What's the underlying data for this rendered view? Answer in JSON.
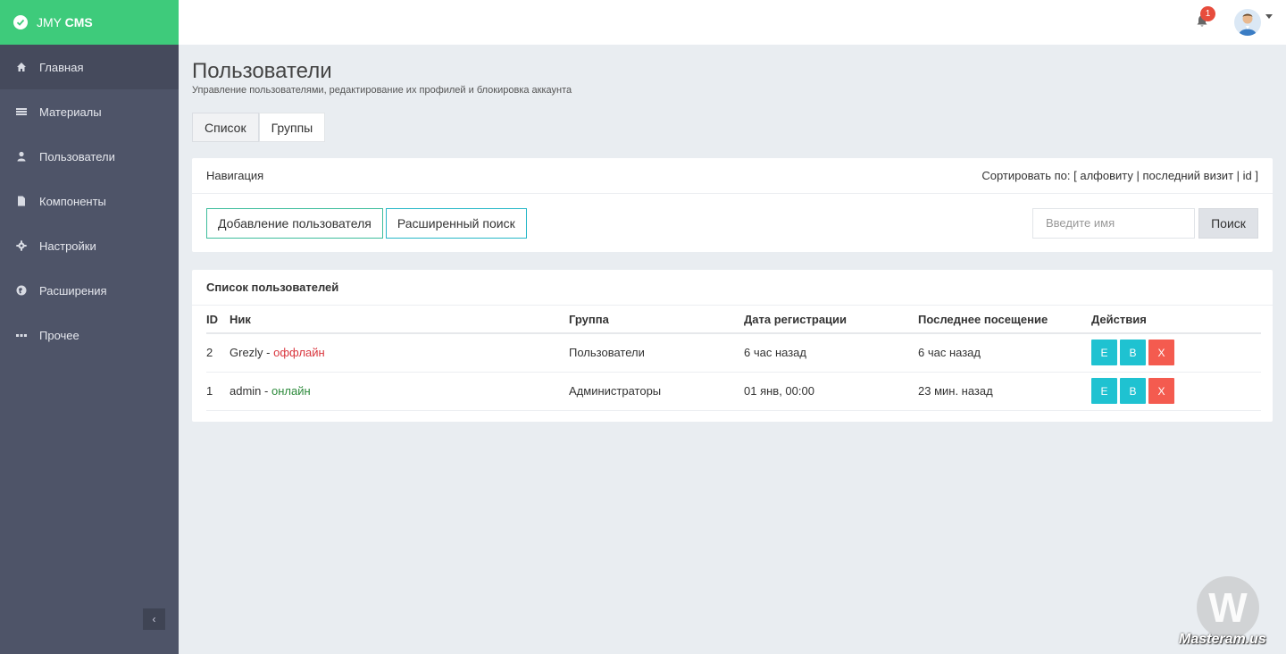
{
  "brand": {
    "prefix": "JMY ",
    "strong": "CMS"
  },
  "sidebar": {
    "items": [
      {
        "label": "Главная",
        "icon": "home-icon"
      },
      {
        "label": "Материалы",
        "icon": "list-icon"
      },
      {
        "label": "Пользователи",
        "icon": "user-icon"
      },
      {
        "label": "Компоненты",
        "icon": "file-icon"
      },
      {
        "label": "Настройки",
        "icon": "gear-icon"
      },
      {
        "label": "Расширения",
        "icon": "globe-icon"
      },
      {
        "label": "Прочее",
        "icon": "ellipsis-icon"
      }
    ],
    "collapse_symbol": "‹"
  },
  "topbar": {
    "notification_count": "1"
  },
  "page": {
    "title": "Пользователи",
    "subtitle": "Управление пользователями, редактирование их профилей и блокировка аккаунта"
  },
  "tabs": [
    {
      "label": "Список"
    },
    {
      "label": "Группы"
    }
  ],
  "nav_panel": {
    "title": "Навигация",
    "sort_prefix": "Сортировать по: [ ",
    "sort_alpha": "алфовиту",
    "sort_sep1": " | ",
    "sort_visit": "последний визит",
    "sort_sep2": " | ",
    "sort_id": "id",
    "sort_suffix": " ]",
    "add_button": "Добавление пользователя",
    "advanced_search_button": "Расширенный поиск",
    "search_placeholder": "Введите имя",
    "search_button": "Поиск"
  },
  "users_panel": {
    "title": "Список пользователей",
    "columns": [
      "ID",
      "Ник",
      "Группа",
      "Дата регистрации",
      "Последнее посещение",
      "Действия"
    ],
    "rows": [
      {
        "id": "2",
        "nick": "Grezly",
        "sep": " - ",
        "status": "оффлайн",
        "group": "Пользователи",
        "registered": "6 час назад",
        "last_visit": "6 час назад"
      },
      {
        "id": "1",
        "nick": "admin",
        "sep": " - ",
        "status": "онлайн",
        "group": "Администраторы",
        "registered": "01 янв, 00:00",
        "last_visit": "23 мин. назад"
      }
    ],
    "actions": {
      "edit": "E",
      "ban": "B",
      "delete": "X"
    }
  },
  "watermark": {
    "logo_letter": "W",
    "text": "Masteram.us"
  },
  "colors": {
    "brand_green": "#3ecb7b",
    "sidebar": "#4e5468",
    "action_teal": "#1fc2d1",
    "action_red": "#f45b4f",
    "offline": "#d9363e",
    "online": "#2d8a3b"
  }
}
